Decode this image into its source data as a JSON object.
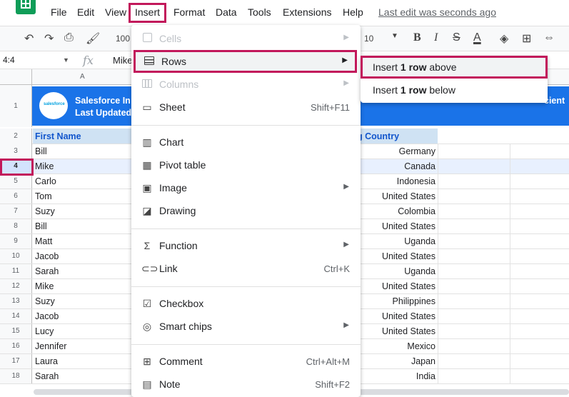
{
  "menu_bar": {
    "items": [
      "File",
      "Edit",
      "View",
      "Insert",
      "Format",
      "Data",
      "Tools",
      "Extensions",
      "Help"
    ],
    "last_edit": "Last edit was seconds ago"
  },
  "toolbar": {
    "zoom": "100",
    "font_size": "10",
    "icons": [
      "undo-icon",
      "redo-icon",
      "print-icon",
      "paint-format-icon",
      "bold-icon",
      "italic-icon",
      "strikethrough-icon",
      "text-color-icon",
      "fill-color-icon",
      "borders-icon",
      "merge-cells-icon"
    ]
  },
  "formula_bar": {
    "cell_ref": "4:4",
    "fx": "fx",
    "value": "Mike"
  },
  "grid": {
    "col_a": "A",
    "banner": {
      "row_number": "1",
      "title": "Salesforce In",
      "subtitle": "Last Updated",
      "right_text": "cient"
    },
    "header": {
      "row_number": "2",
      "first_name": "First Name",
      "country": "g Country"
    },
    "rows": [
      {
        "num": "3",
        "name": "Bill",
        "country": "Germany"
      },
      {
        "num": "4",
        "name": "Mike",
        "country": "Canada"
      },
      {
        "num": "5",
        "name": "Carlo",
        "country": "Indonesia"
      },
      {
        "num": "6",
        "name": "Tom",
        "country": "United States"
      },
      {
        "num": "7",
        "name": "Suzy",
        "country": "Colombia"
      },
      {
        "num": "8",
        "name": "Bill",
        "country": "United States"
      },
      {
        "num": "9",
        "name": "Matt",
        "country": "Uganda"
      },
      {
        "num": "10",
        "name": "Jacob",
        "country": "United States"
      },
      {
        "num": "11",
        "name": "Sarah",
        "country": "Uganda"
      },
      {
        "num": "12",
        "name": "Mike",
        "country": "United States"
      },
      {
        "num": "13",
        "name": "Suzy",
        "country": "Philippines"
      },
      {
        "num": "14",
        "name": "Jacob",
        "country": "United States"
      },
      {
        "num": "15",
        "name": "Lucy",
        "country": "United States"
      },
      {
        "num": "16",
        "name": "Jennifer",
        "country": "Mexico"
      },
      {
        "num": "17",
        "name": "Laura",
        "country": "Japan"
      },
      {
        "num": "18",
        "name": "Sarah",
        "country": "India"
      }
    ]
  },
  "insert_menu": {
    "cells": "Cells",
    "rows": "Rows",
    "columns": "Columns",
    "sheet": "Sheet",
    "sheet_shortcut": "Shift+F11",
    "chart": "Chart",
    "pivot_table": "Pivot table",
    "image": "Image",
    "drawing": "Drawing",
    "function": "Function",
    "link": "Link",
    "link_shortcut": "Ctrl+K",
    "checkbox": "Checkbox",
    "smart_chips": "Smart chips",
    "comment": "Comment",
    "comment_shortcut": "Ctrl+Alt+M",
    "note": "Note",
    "note_shortcut": "Shift+F2"
  },
  "rows_submenu": {
    "above": {
      "pre": "Insert ",
      "bold": "1 row",
      "post": " above"
    },
    "below": {
      "pre": "Insert ",
      "bold": "1 row",
      "post": " below"
    }
  },
  "colors": {
    "highlight": "#c2185b",
    "banner": "#1a73e8",
    "header_fill": "#cfe2f3",
    "header_text": "#1155cc",
    "sheets_green": "#0f9d58"
  }
}
